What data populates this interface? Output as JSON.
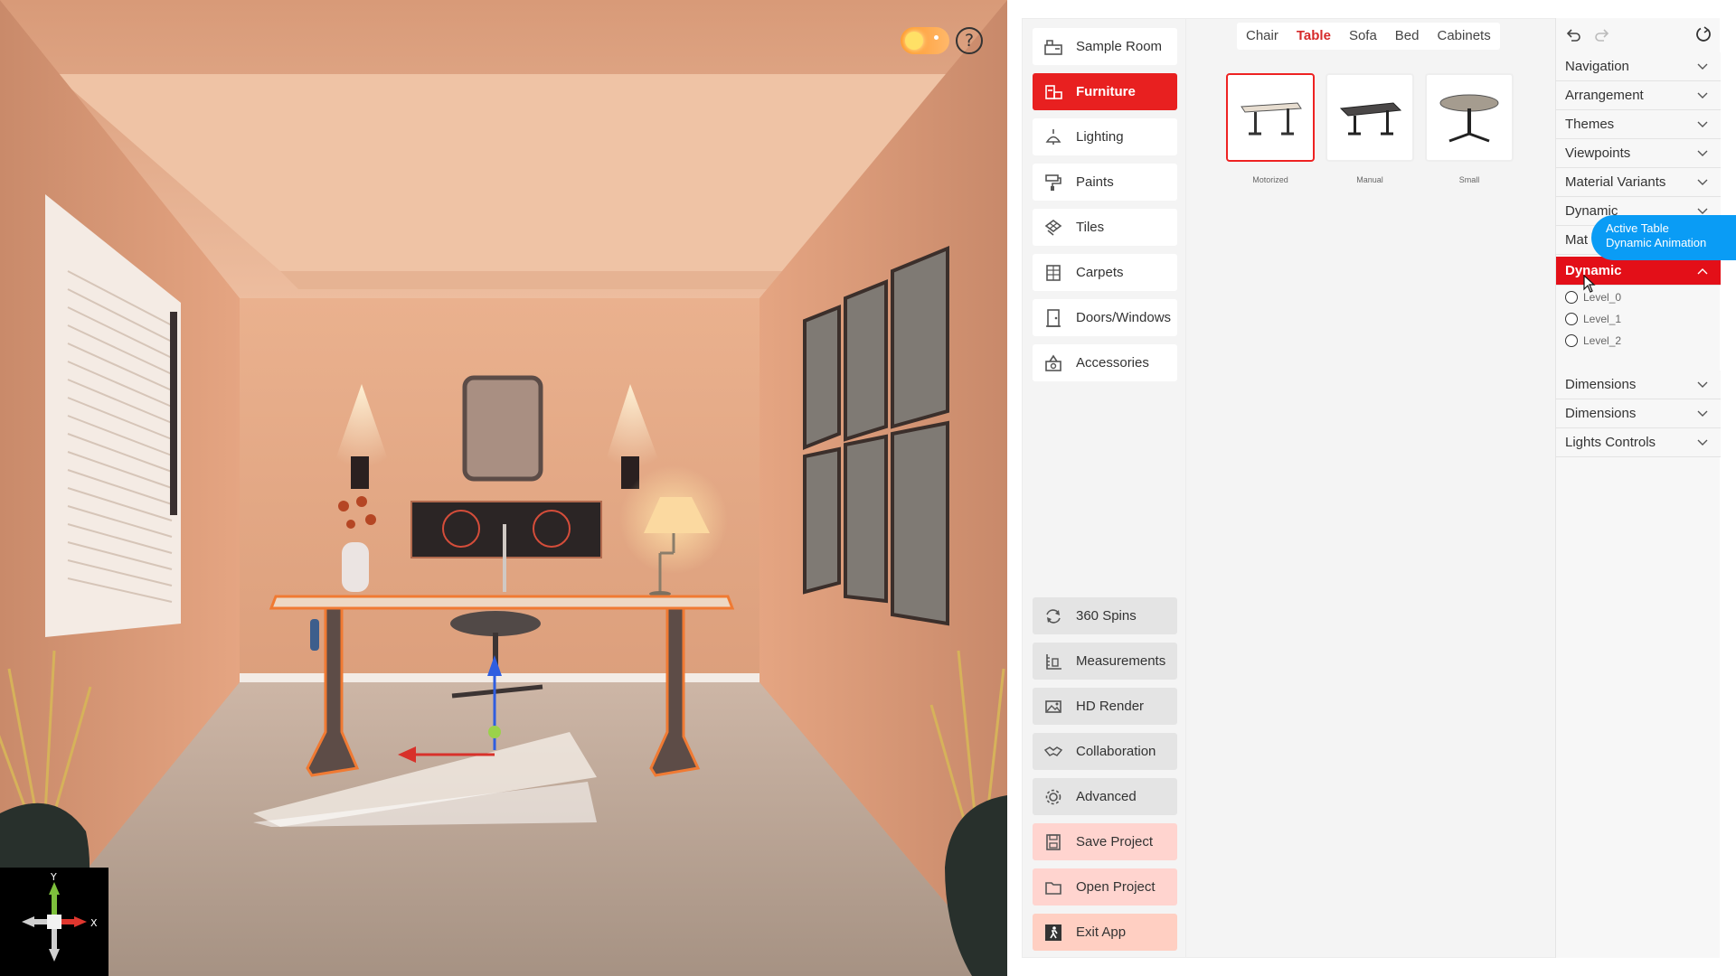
{
  "viewport": {
    "help_label": "?",
    "gizmo": {
      "y_label": "Y",
      "x_label": "X"
    }
  },
  "categories": [
    {
      "label": "Sample Room",
      "icon": "sample-room-icon",
      "active": false
    },
    {
      "label": "Furniture",
      "icon": "furniture-icon",
      "active": true
    },
    {
      "label": "Lighting",
      "icon": "lighting-icon",
      "active": false
    },
    {
      "label": "Paints",
      "icon": "paint-roller-icon",
      "active": false
    },
    {
      "label": "Tiles",
      "icon": "tiles-icon",
      "active": false
    },
    {
      "label": "Carpets",
      "icon": "carpet-icon",
      "active": false
    },
    {
      "label": "Doors/Windows",
      "icon": "door-icon",
      "active": false
    },
    {
      "label": "Accessories",
      "icon": "accessories-icon",
      "active": false
    }
  ],
  "tools": [
    {
      "label": "360 Spins",
      "icon": "rotate-icon"
    },
    {
      "label": "Measurements",
      "icon": "ruler-icon"
    },
    {
      "label": "HD Render",
      "icon": "image-icon"
    },
    {
      "label": "Collaboration",
      "icon": "handshake-icon"
    },
    {
      "label": "Advanced",
      "icon": "gear-icon"
    },
    {
      "label": "Save Project",
      "icon": "save-icon"
    },
    {
      "label": "Open Project",
      "icon": "folder-icon"
    },
    {
      "label": "Exit App",
      "icon": "exit-icon"
    }
  ],
  "sub_tabs": [
    {
      "label": "Chair",
      "active": false
    },
    {
      "label": "Table",
      "active": true
    },
    {
      "label": "Sofa",
      "active": false
    },
    {
      "label": "Bed",
      "active": false
    },
    {
      "label": "Cabinets",
      "active": false
    }
  ],
  "items": [
    {
      "label": "Motorized",
      "active": true
    },
    {
      "label": "Manual",
      "active": false
    },
    {
      "label": "Small",
      "active": false
    }
  ],
  "settings": {
    "sections": [
      {
        "label": "Navigation",
        "open": false
      },
      {
        "label": "Arrangement",
        "open": false
      },
      {
        "label": "Themes",
        "open": false
      },
      {
        "label": "Viewpoints",
        "open": false
      },
      {
        "label": "Material Variants",
        "open": false
      },
      {
        "label": "Dynamic",
        "open": false
      },
      {
        "label": "Mat",
        "open": false
      },
      {
        "label": "Dynamic",
        "open": true
      },
      {
        "label": "Dimensions",
        "open": false
      },
      {
        "label": "Dimensions",
        "open": false
      },
      {
        "label": "Lights Controls",
        "open": false
      }
    ],
    "dynamic_levels": [
      "Level_0",
      "Level_1",
      "Level_2"
    ],
    "tooltip": {
      "line1": "Active Table",
      "line2": "Dynamic Animation"
    }
  },
  "colors": {
    "accent_red": "#e30f18",
    "tooltip_blue": "#0a9cf5",
    "project_button_pink": "#ffd4cf",
    "wall_peach": "#e9ab87"
  }
}
